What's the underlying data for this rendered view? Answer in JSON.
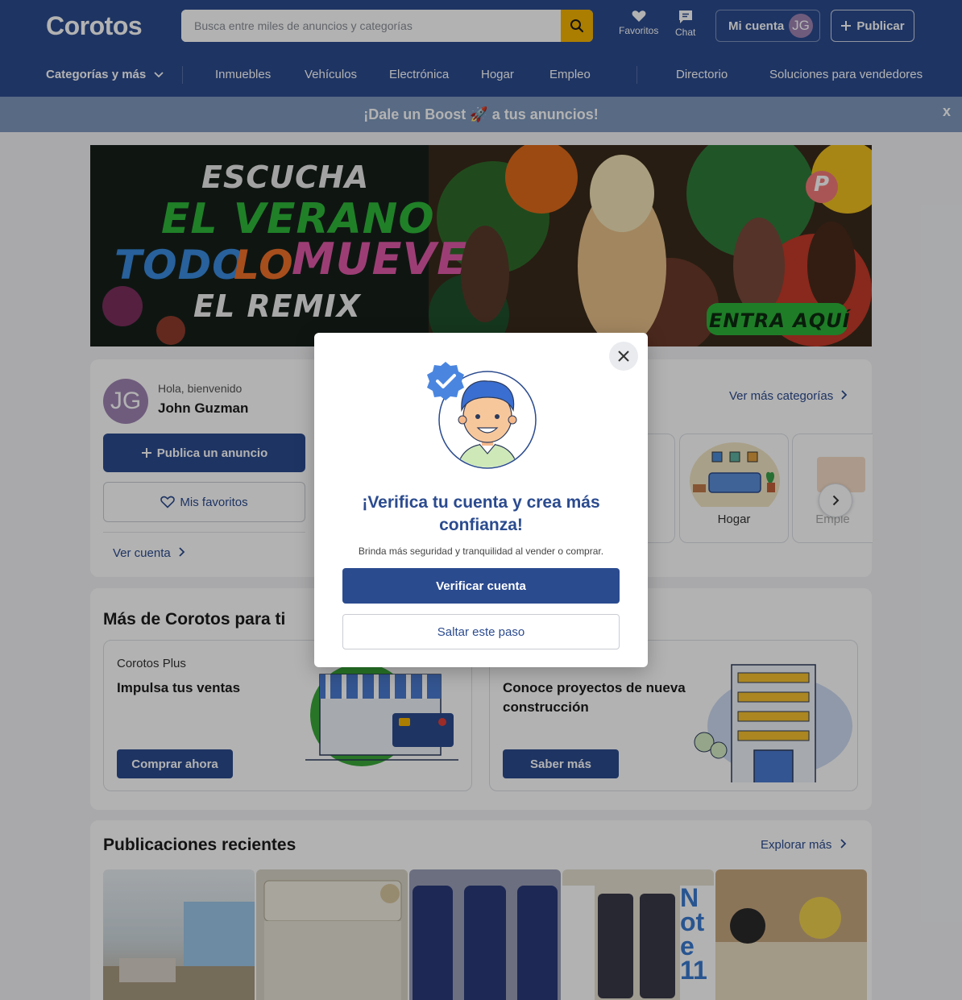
{
  "header": {
    "logo": "Corotos",
    "search_placeholder": "Busca entre miles de anuncios y categorías",
    "favoritos": "Favoritos",
    "chat": "Chat",
    "account_label": "Mi cuenta",
    "avatar_initials": "JG",
    "publish_label": "Publicar"
  },
  "nav": {
    "categories": "Categorías y más",
    "items": [
      "Inmuebles",
      "Vehículos",
      "Electrónica",
      "Hogar",
      "Empleo"
    ],
    "directorio": "Directorio",
    "soluciones": "Soluciones para vendedores"
  },
  "boost": {
    "text": "¡Dale un Boost 🚀 a tus anuncios!",
    "close": "x"
  },
  "banner": {
    "line1": "ESCUCHA",
    "line2": "EL VERANO",
    "line3a": "TODO",
    "line3b": "LO",
    "line3c": "MUEVE",
    "line4": "EL REMIX",
    "cta": "ENTRA AQUÍ",
    "badge": "P"
  },
  "user_card": {
    "avatar_initials": "JG",
    "greeting": "Hola, bienvenido",
    "name": "John Guzman",
    "publish_button": "Publica un anuncio",
    "favorites_button": "Mis favoritos",
    "view_account": "Ver cuenta",
    "more_categories": "Ver más categorías",
    "category_hogar": "Hogar",
    "category_empleo": "Emple"
  },
  "mas": {
    "title": "Más de Corotos para ti",
    "plus_kicker": "Corotos Plus",
    "plus_title": "Impulsa tus ventas",
    "plus_cta": "Comprar ahora",
    "proj_title": "Conoce proyectos de nueva construcción",
    "proj_cta": "Saber más"
  },
  "recientes": {
    "title": "Publicaciones recientes",
    "explore": "Explorar más",
    "note_label": "Note 11"
  },
  "modal": {
    "title": "¡Verifica tu cuenta y crea más confianza!",
    "subtitle": "Brinda más seguridad y tranquilidad al vender o comprar.",
    "verify_button": "Verificar cuenta",
    "skip_button": "Saltar este paso"
  },
  "colors": {
    "brand": "#2b4b8f",
    "accent": "#f5b400",
    "overlay": "rgba(0,0,0,0.30)"
  }
}
